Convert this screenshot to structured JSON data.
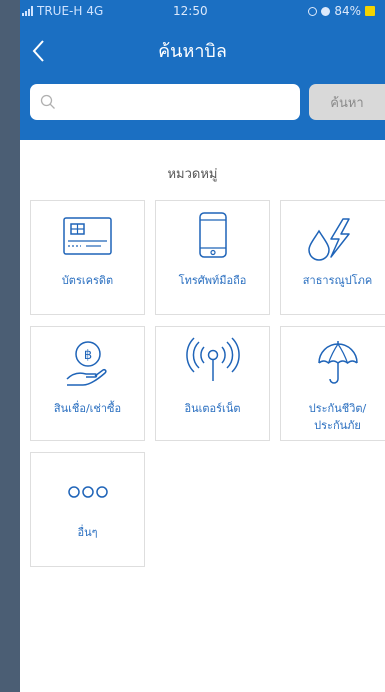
{
  "status_bar": {
    "carrier": "TRUE-H",
    "network": "4G",
    "time": "12:50",
    "battery": "84%"
  },
  "header": {
    "title": "ค้นหาบิล",
    "back_icon": "chevron-left-icon"
  },
  "search": {
    "placeholder": "",
    "value": "",
    "button_label": "ค้นหา",
    "icon": "search-icon"
  },
  "categories": {
    "section_title": "หมวดหมู่",
    "items": [
      {
        "label": "บัตรเครดิต",
        "icon": "credit-card-icon"
      },
      {
        "label": "โทรศัพท์มือถือ",
        "icon": "mobile-phone-icon"
      },
      {
        "label": "สาธารณูปโภค",
        "icon": "utilities-icon"
      },
      {
        "label": "สินเชื่อ/เช่าซื้อ",
        "icon": "loan-icon"
      },
      {
        "label": "อินเตอร์เน็ต",
        "icon": "internet-icon"
      },
      {
        "label_line1": "ประกันชีวิต/",
        "label_line2": "ประกันภัย",
        "icon": "umbrella-icon"
      },
      {
        "label": "อื่นๆ",
        "icon": "more-icon"
      }
    ]
  },
  "colors": {
    "header_bg": "#1b6fc2",
    "accent_text": "#2a6fc0",
    "icon_stroke": "#1f64b8"
  }
}
